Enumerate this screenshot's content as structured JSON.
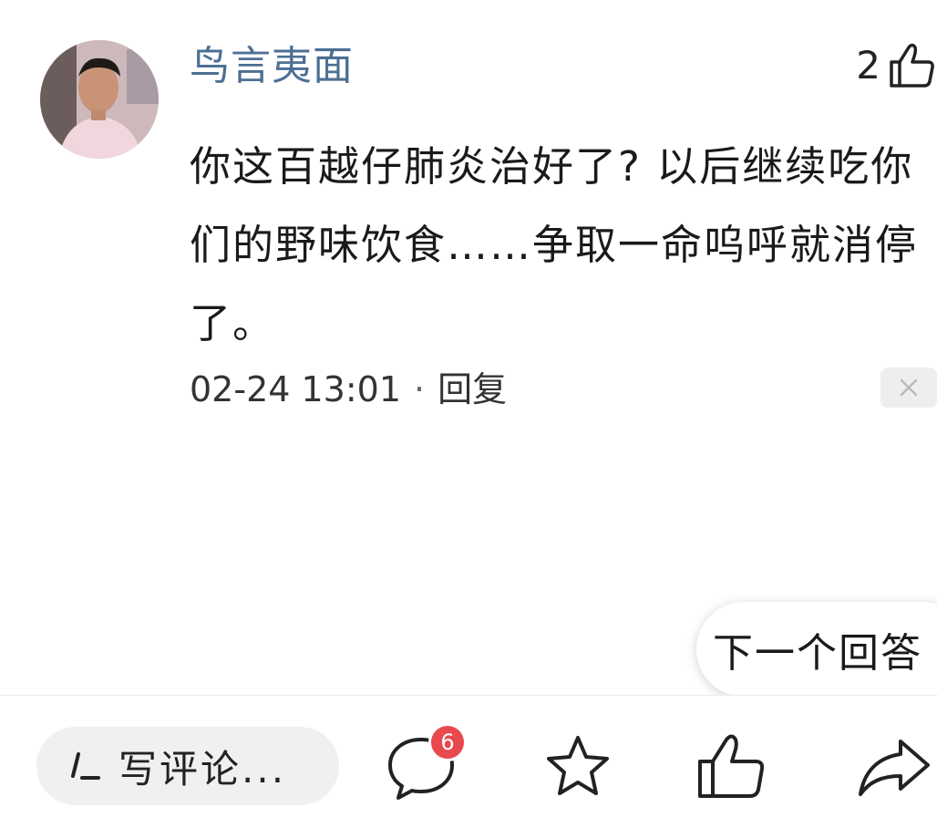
{
  "comment": {
    "username": "鸟言夷面",
    "like_count": "2",
    "text": "你这百越仔肺炎治好了? 以后继续吃你们的野味饮食……争取一命呜呼就消停了。",
    "timestamp": "02-24 13:01",
    "separator": "·",
    "reply_label": "回复"
  },
  "next_answer_label": "下一个回答",
  "bottom_bar": {
    "write_comment_placeholder": "写评论...",
    "comment_badge_count": "6"
  },
  "icons": {
    "like": "thumbs-up-icon",
    "dismiss": "close-icon",
    "pen": "pen-icon",
    "comment": "comment-bubble-icon",
    "favorite": "star-icon",
    "thumbs_up": "thumbs-up-icon",
    "share": "share-arrow-icon"
  },
  "colors": {
    "username": "#4d6f93",
    "badge": "#e8494d",
    "text": "#1a1a1a"
  }
}
